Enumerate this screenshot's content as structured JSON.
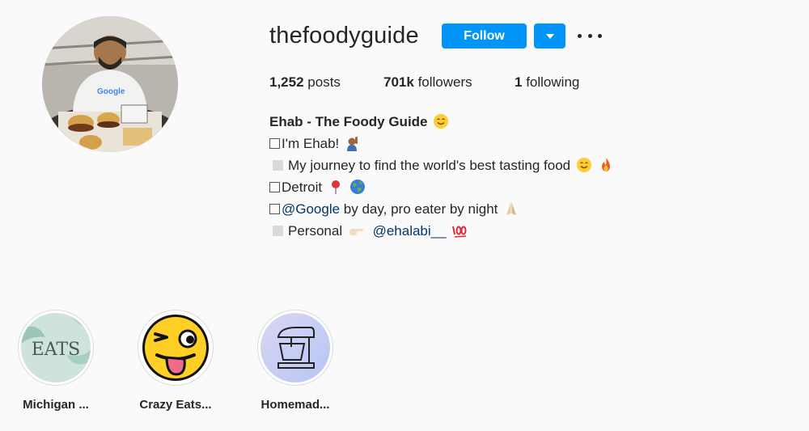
{
  "profile": {
    "username": "thefoodyguide",
    "follow_label": "Follow",
    "stats": {
      "posts_count": "1,252",
      "posts_label": "posts",
      "followers_count": "701k",
      "followers_label": "followers",
      "following_count": "1",
      "following_label": "following"
    },
    "bio": {
      "full_name": "Ehab - The Foody Guide",
      "line1": "I'm Ehab!",
      "line2": "My journey to find the world's best tasting food",
      "line3": "Detroit",
      "line4_mention": "@Google",
      "line4_text": " by day, pro eater by night",
      "line5_text": "Personal",
      "line5_mention": "@ehalabi__"
    },
    "avatar_shirt_text": "Google"
  },
  "highlights": [
    {
      "label": "Michigan ...",
      "cover_text": "EATS"
    },
    {
      "label": "Crazy Eats..."
    },
    {
      "label": "Homemad..."
    }
  ],
  "colors": {
    "accent": "#0095f6",
    "mention": "#00376b",
    "background": "#fafafa"
  },
  "icons": [
    "smiling-face-emoji",
    "raising-hand-emoji",
    "fire-emoji",
    "round-pushpin-emoji",
    "globe-emoji",
    "folded-hands-emoji",
    "pointing-right-emoji",
    "hundred-points-emoji",
    "caret-down-icon",
    "more-options-icon"
  ]
}
